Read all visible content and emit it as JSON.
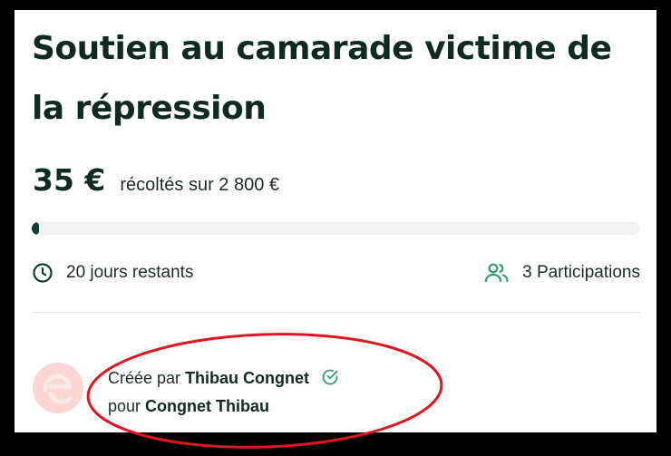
{
  "campaign": {
    "title": "Soutien au camarade victime de la répression",
    "amount_raised": "35 €",
    "goal_text": "récoltés sur 2 800 €",
    "progress_fraction": 0.0125,
    "days_left": "20 jours restants",
    "participations": "3 Participations"
  },
  "creator": {
    "created_by_prefix": "Créée par",
    "creator_name": "Thibau Congnet",
    "for_prefix": "pour",
    "beneficiary_name": "Congnet Thibau",
    "verified_icon": "check-circle-icon"
  },
  "icons": {
    "clock": "clock-icon",
    "users": "users-icon"
  },
  "colors": {
    "heading": "#0f2a22",
    "progress_fill": "#123d32",
    "progress_track": "#f0f1f0",
    "accent_green": "#2f9e6d",
    "annotation_red": "#e0151f",
    "avatar_bg": "#f9d6d3"
  }
}
